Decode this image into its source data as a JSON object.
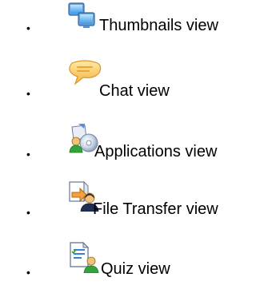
{
  "views": {
    "items": [
      {
        "label": "Thumbnails view",
        "icon": "thumbnails-icon"
      },
      {
        "label": "Chat view",
        "icon": "chat-icon"
      },
      {
        "label": "Applications view",
        "icon": "applications-icon"
      },
      {
        "label": "File Transfer view",
        "icon": "file-transfer-icon"
      },
      {
        "label": "Quiz view",
        "icon": "quiz-icon"
      }
    ]
  }
}
